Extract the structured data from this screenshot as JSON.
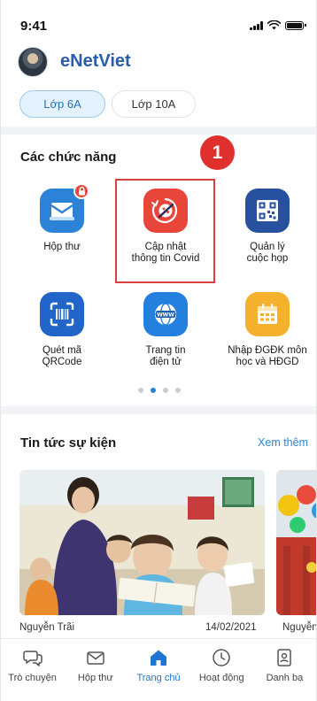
{
  "status_bar": {
    "time": "9:41"
  },
  "header": {
    "app_title": "eNetViet"
  },
  "class_tabs": [
    {
      "label": "Lớp 6A",
      "active": true
    },
    {
      "label": "Lớp 10A",
      "active": false
    }
  ],
  "functions": {
    "title": "Các chức năng",
    "step_badge": "1",
    "items": [
      {
        "label_line1": "Hộp thư",
        "label_line2": "",
        "icon": "mailbox-icon",
        "locked": true
      },
      {
        "label_line1": "Cập nhật",
        "label_line2": "thông tin Covid",
        "icon": "covid-update-icon",
        "highlighted": true
      },
      {
        "label_line1": "Quản lý",
        "label_line2": "cuộc họp",
        "icon": "qr-meeting-icon"
      },
      {
        "label_line1": "Quét mã",
        "label_line2": "QRCode",
        "icon": "qr-scan-icon"
      },
      {
        "label_line1": "Trang tin",
        "label_line2": "điện tử",
        "icon": "globe-www-icon"
      },
      {
        "label_line1": "Nhập ĐGĐK môn",
        "label_line2": "học và HĐGD",
        "icon": "calendar-grid-icon"
      }
    ],
    "page_dots": {
      "count": 4,
      "active_index": 1
    }
  },
  "news": {
    "title": "Tin tức sự kiện",
    "see_more": "Xem thêm",
    "cards": [
      {
        "source": "Nguyễn Trãi",
        "date": "14/02/2021"
      },
      {
        "source": "Nguyễn",
        "date": ""
      }
    ]
  },
  "bottom_nav": [
    {
      "label": "Trò chuyện",
      "icon": "chat-bubbles-icon",
      "active": false
    },
    {
      "label": "Hộp thư",
      "icon": "envelope-icon",
      "active": false
    },
    {
      "label": "Trang chủ",
      "icon": "home-icon",
      "active": true
    },
    {
      "label": "Hoạt động",
      "icon": "clock-icon",
      "active": false
    },
    {
      "label": "Danh bạ",
      "icon": "contacts-icon",
      "active": false
    }
  ],
  "colors": {
    "brand_blue": "#2a5cab",
    "accent_blue": "#1f76d2",
    "highlight_red": "#d8413c",
    "covid_red": "#e8463b",
    "tile_gold": "#f5b02e"
  }
}
